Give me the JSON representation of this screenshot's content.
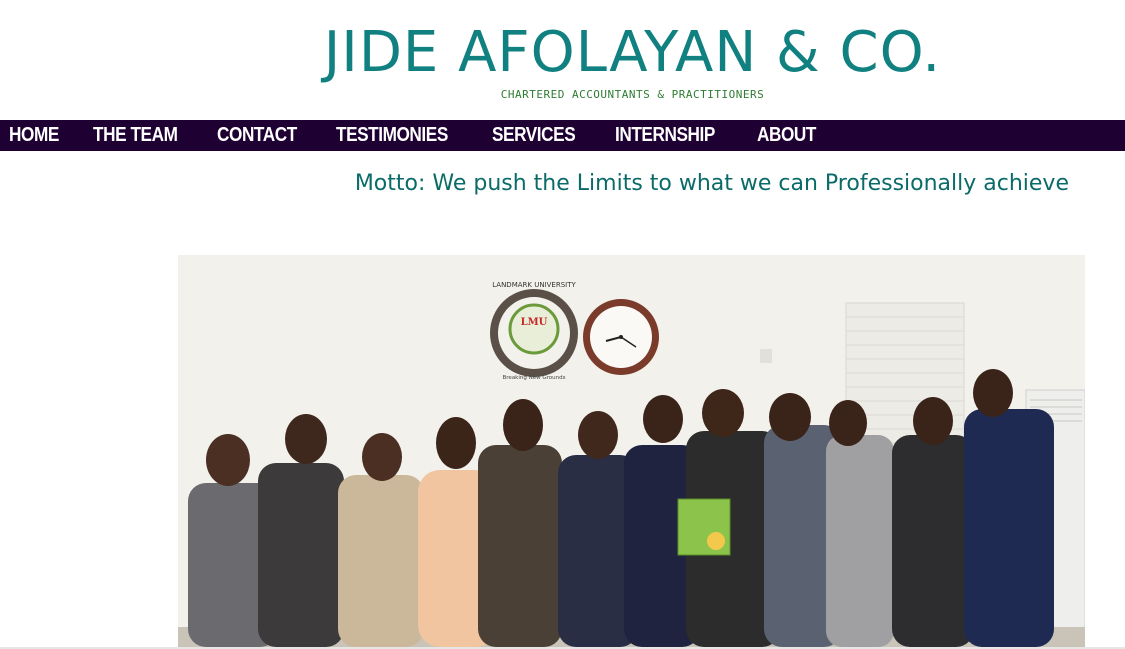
{
  "site": {
    "title": "JIDE AFOLAYAN & CO.",
    "tagline": "CHARTERED ACCOUNTANTS & PRACTITIONERS"
  },
  "nav": {
    "items": [
      {
        "label": "HOME"
      },
      {
        "label": "THE TEAM"
      },
      {
        "label": "CONTACT"
      },
      {
        "label": "TESTIMONIES"
      },
      {
        "label": "SERVICES"
      },
      {
        "label": "INTERNSHIP"
      },
      {
        "label": "ABOUT"
      }
    ]
  },
  "motto": "Motto: We push the Limits to what we can Professionally achieve",
  "photo": {
    "logo_text": "LANDMARK UNIVERSITY",
    "logo_abbr": "LMU",
    "logo_slogan": "Breaking New Grounds"
  },
  "colors": {
    "title": "#118080",
    "tagline": "#2e7d32",
    "navbar": "#1e0032",
    "motto": "#0b6b68"
  }
}
